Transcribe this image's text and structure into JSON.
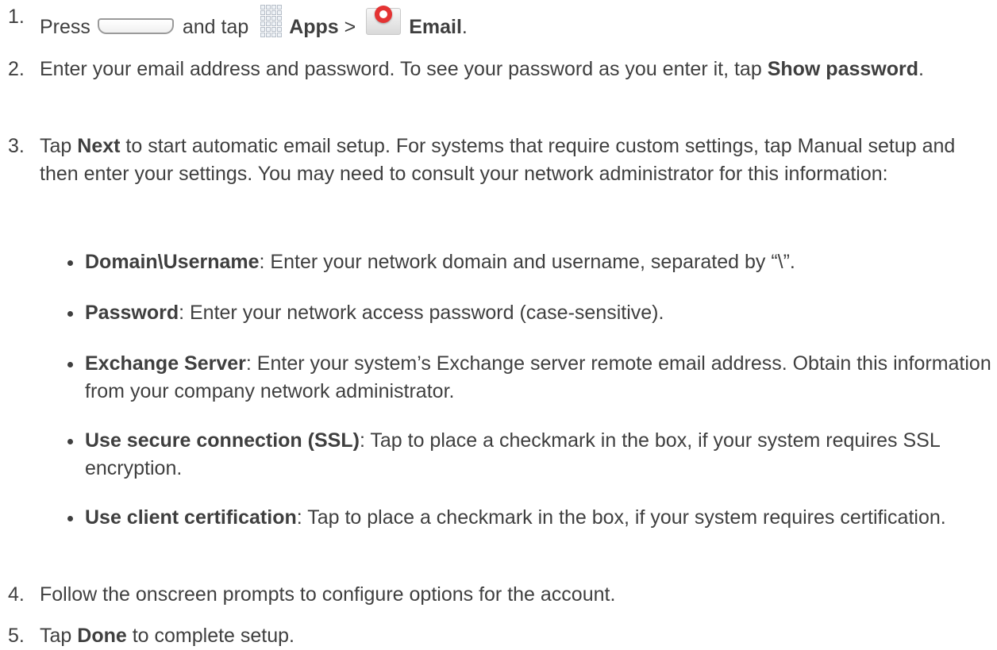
{
  "steps": [
    {
      "num": "1.",
      "press": "Press",
      "and_tap": "and tap",
      "apps": "Apps",
      "sep": ">",
      "email": "Email",
      "end": "."
    },
    {
      "num": "2.",
      "text": "Enter your email address and password. To see your password as you enter it, tap",
      "bold": "Show password",
      "end": "."
    },
    {
      "num": "3.",
      "tap": "Tap",
      "bold": "Next",
      "text": "to start automatic email setup. For systems that require custom settings, tap Manual setup and then enter your settings. You may need to consult your network administrator for this information:"
    },
    {
      "num": "4.",
      "text": "Follow the onscreen prompts to configure options for the account."
    },
    {
      "num": "5.",
      "tap": "Tap",
      "bold": "Done",
      "text": "to complete setup."
    }
  ],
  "bullets": [
    {
      "term": "Domain\\Username",
      "text": ": Enter your network domain and username, separated by “\\”."
    },
    {
      "term": "Password",
      "text": ": Enter your network access password (case-sensitive)."
    },
    {
      "term": "Exchange Server",
      "text": ": Enter your system’s Exchange server remote email address. Obtain this information from your company network administrator."
    },
    {
      "term": "Use secure connection (SSL)",
      "text": ": Tap to place a checkmark in the box, if your system requires SSL encryption."
    },
    {
      "term": "Use client certification",
      "text": ": Tap to place a checkmark in the box, if your system requires certification."
    }
  ],
  "icons": {
    "home_key": "home-key-icon",
    "apps": "apps-grid-icon",
    "email": "email-app-icon"
  }
}
